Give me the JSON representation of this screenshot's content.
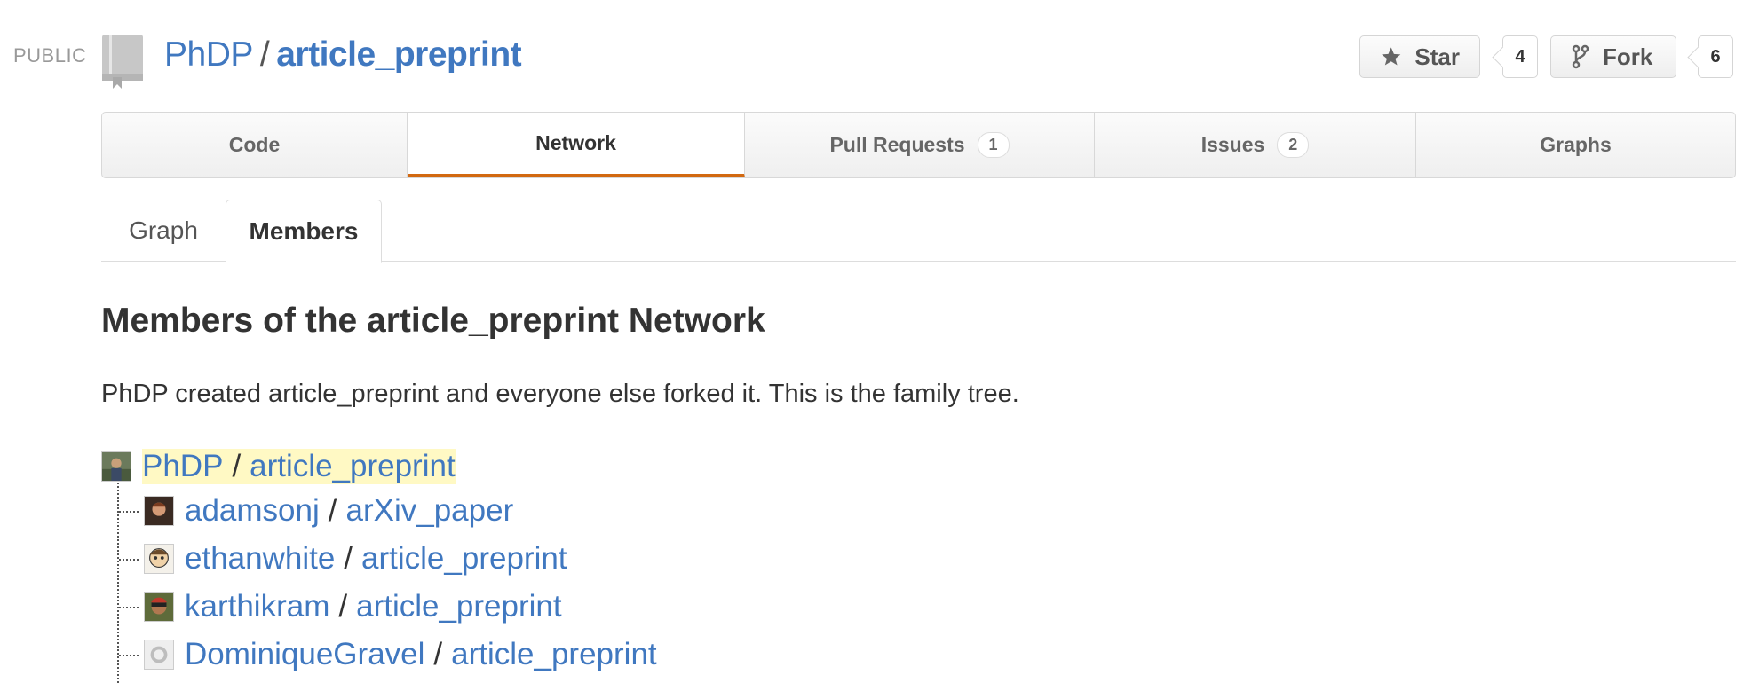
{
  "header": {
    "visibility": "PUBLIC",
    "owner": "PhDP",
    "separator": "/",
    "repo": "article_preprint",
    "star_label": "Star",
    "star_count": "4",
    "fork_label": "Fork",
    "fork_count": "6"
  },
  "nav": {
    "tabs": [
      {
        "label": "Code",
        "count": ""
      },
      {
        "label": "Network",
        "count": "",
        "selected": true
      },
      {
        "label": "Pull Requests",
        "count": "1"
      },
      {
        "label": "Issues",
        "count": "2"
      },
      {
        "label": "Graphs",
        "count": ""
      }
    ]
  },
  "subnav": {
    "tabs": [
      "Graph",
      "Members"
    ],
    "selected": "Members"
  },
  "page": {
    "title": "Members of the article_preprint Network",
    "description": "PhDP created article_preprint and everyone else forked it. This is the family tree."
  },
  "tree": {
    "root": {
      "owner": "PhDP",
      "repo": "article_preprint"
    },
    "children": [
      {
        "owner": "adamsonj",
        "repo": "arXiv_paper"
      },
      {
        "owner": "ethanwhite",
        "repo": "article_preprint"
      },
      {
        "owner": "karthikram",
        "repo": "article_preprint"
      },
      {
        "owner": "DominiqueGravel",
        "repo": "article_preprint"
      }
    ]
  },
  "colors": {
    "link": "#4078c0",
    "accent": "#d26911",
    "highlight": "#fff9c4"
  }
}
